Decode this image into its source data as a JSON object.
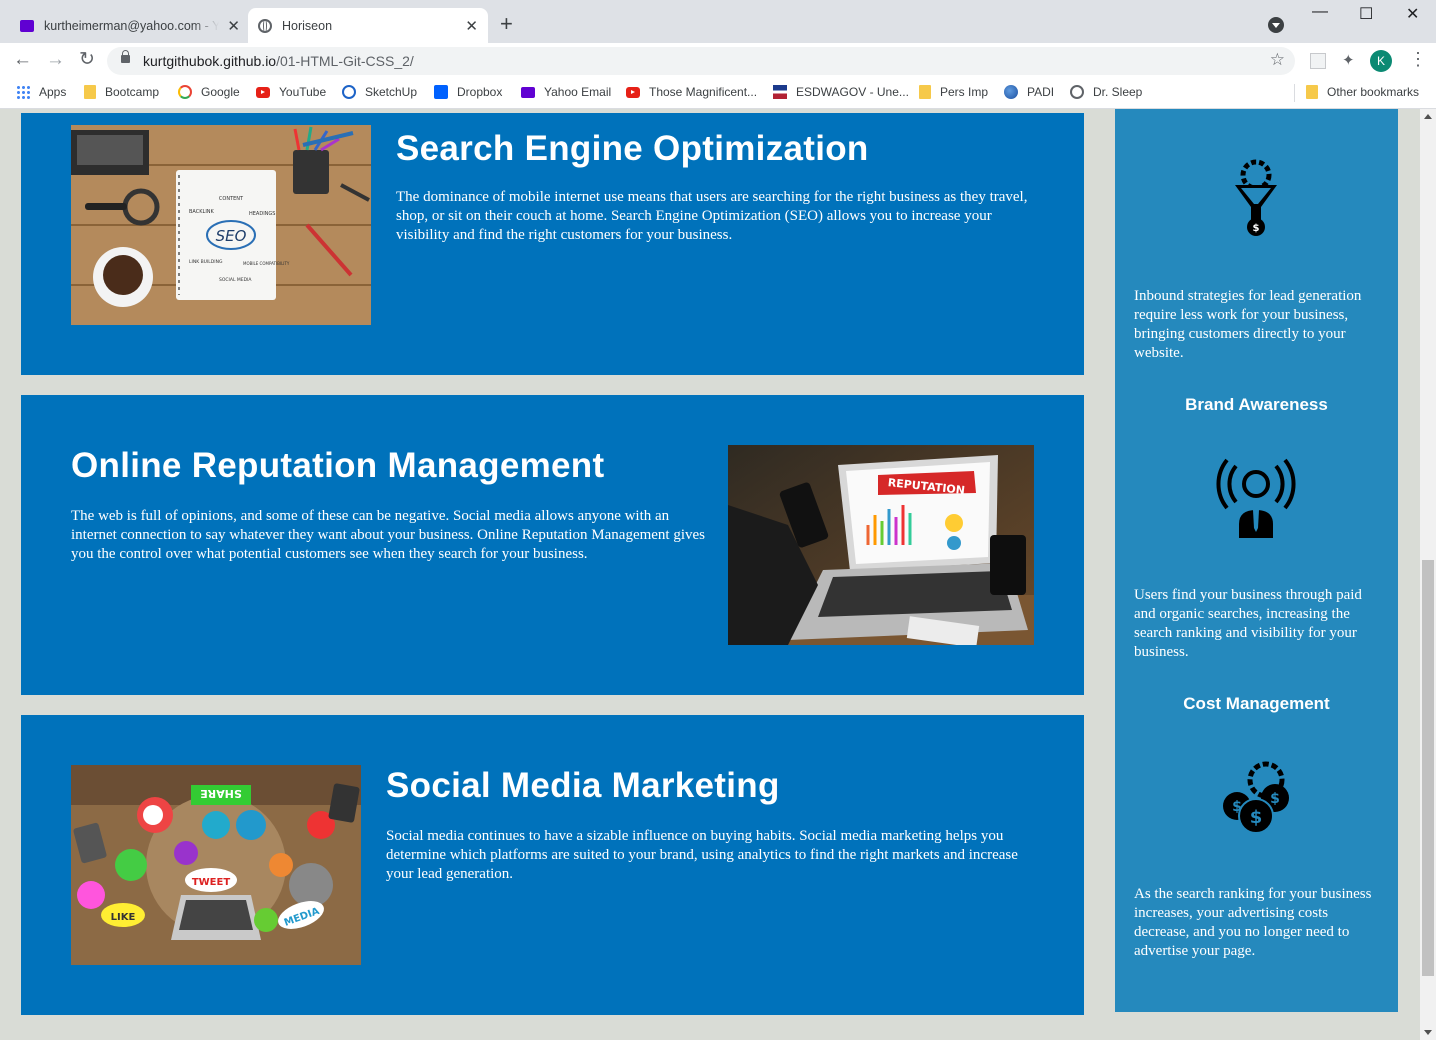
{
  "browser": {
    "tabs": [
      {
        "title": "kurtheimerman@yahoo.com - Yahoo Mail",
        "icon": "yahoo-mail-icon"
      },
      {
        "title": "Horiseon",
        "icon": "globe-icon"
      }
    ],
    "url_host": "kurtgithubok.github.io",
    "url_path": "/01-HTML-Git-CSS_2/",
    "profile_initial": "K",
    "bookmarks": [
      {
        "label": "Apps",
        "icon": "apps-grid-icon"
      },
      {
        "label": "Bootcamp",
        "icon": "folder-icon"
      },
      {
        "label": "Google",
        "icon": "google-icon"
      },
      {
        "label": "YouTube",
        "icon": "youtube-icon"
      },
      {
        "label": "SketchUp",
        "icon": "sketchup-icon"
      },
      {
        "label": "Dropbox",
        "icon": "dropbox-icon"
      },
      {
        "label": "Yahoo Email",
        "icon": "yahoo-icon"
      },
      {
        "label": "Those Magnificent...",
        "icon": "youtube-icon"
      },
      {
        "label": "ESDWAGOV - Une...",
        "icon": "flag-icon"
      },
      {
        "label": "Pers Imp",
        "icon": "folder-icon"
      },
      {
        "label": "PADI",
        "icon": "earth-icon"
      },
      {
        "label": "Dr. Sleep",
        "icon": "site-icon"
      }
    ],
    "other_bookmarks": "Other bookmarks"
  },
  "content": {
    "sections": [
      {
        "title": "Search Engine Optimization",
        "text": "The dominance of mobile internet use means that users are searching for the right business as they travel, shop, or sit on their couch at home. Search Engine Optimization (SEO) allows you to increase your visibility and find the right customers for your business.",
        "image_labels": [
          "SEO",
          "CONTENT",
          "BACKLINK",
          "HEADINGS",
          "LINK BUILDING",
          "MOBILE COMPATIBILITY",
          "SOCIAL MEDIA"
        ]
      },
      {
        "title": "Online Reputation Management",
        "text": "The web is full of opinions, and some of these can be negative. Social media allows anyone with an internet connection to say whatever they want about your business. Online Reputation Management gives you the control over what potential customers see when they search for your business.",
        "image_labels": [
          "REPUTATION"
        ]
      },
      {
        "title": "Social Media Marketing",
        "text": "Social media continues to have a sizable influence on buying habits. Social media marketing helps you determine which platforms are suited to your brand, using analytics to find the right markets and increase your lead generation.",
        "image_labels": [
          "SHARE",
          "TWEET",
          "LIKE",
          "MEDIA"
        ]
      }
    ]
  },
  "aside": {
    "blocks": [
      {
        "icon": "lead-generation-funnel-icon",
        "title": "",
        "text": "Inbound strategies for lead generation require less work for your business, bringing customers directly to your website."
      },
      {
        "icon": "brand-awareness-broadcast-icon",
        "title": "Brand Awareness",
        "text": "Users find your business through paid and organic searches, increasing the search ranking and visibility for your business."
      },
      {
        "icon": "cost-management-coins-icon",
        "title": "Cost Management",
        "text": "As the search ranking for your business increases, your advertising costs decrease, and you no longer need to advertise your page."
      }
    ]
  },
  "colors": {
    "content_blue": "#0072bb",
    "aside_blue": "#2589bd",
    "page_background": "#d9dcd6"
  }
}
